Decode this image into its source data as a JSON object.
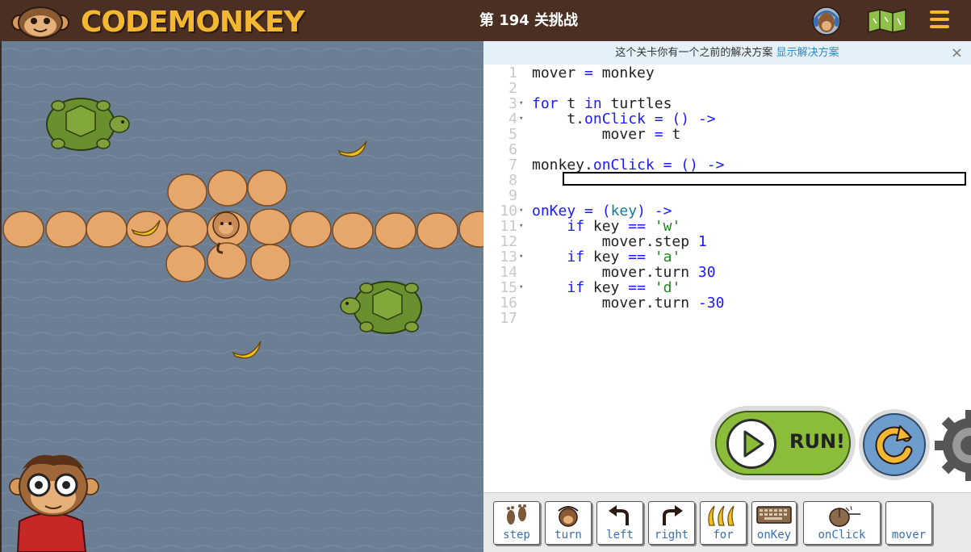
{
  "header": {
    "logo_text": "CODEMONKEY",
    "level_title": "第 194 关挑战",
    "avatar_icon": "monkey-headphones-icon",
    "map_icon": "map-icon",
    "menu_icon": "hamburger-menu-icon",
    "accent_color": "#f4b731",
    "bg_color": "#4b2f22"
  },
  "notice": {
    "text": "这个关卡你有一个之前的解决方案",
    "link": "显示解决方案",
    "close": "×"
  },
  "editor": {
    "lines": [
      {
        "n": "1",
        "fold": ""
      },
      {
        "n": "2",
        "fold": ""
      },
      {
        "n": "3",
        "fold": "▾"
      },
      {
        "n": "4",
        "fold": "▾"
      },
      {
        "n": "5",
        "fold": ""
      },
      {
        "n": "6",
        "fold": ""
      },
      {
        "n": "7",
        "fold": ""
      },
      {
        "n": "8",
        "fold": ""
      },
      {
        "n": "9",
        "fold": ""
      },
      {
        "n": "10",
        "fold": "▾"
      },
      {
        "n": "11",
        "fold": "▾"
      },
      {
        "n": "12",
        "fold": ""
      },
      {
        "n": "13",
        "fold": "▾"
      },
      {
        "n": "14",
        "fold": ""
      },
      {
        "n": "15",
        "fold": "▾"
      },
      {
        "n": "16",
        "fold": ""
      },
      {
        "n": "17",
        "fold": ""
      }
    ],
    "code": [
      "mover = monkey",
      "",
      "for t in turtles",
      "    t.onClick = () ->",
      "        mover = t",
      "",
      "monkey.onClick = () ->",
      "",
      "",
      "onKey = (key) ->",
      "    if key == 'w'",
      "        mover.step 1",
      "    if key == 'a'",
      "        mover.turn 30",
      "    if key == 'd'",
      "        mover.turn -30",
      ""
    ]
  },
  "run": {
    "label": "RUN!",
    "play_icon": "play-icon",
    "reset_icon": "reset-arrow-icon",
    "settings_icon": "gear-icon",
    "color": "#8bbc3a"
  },
  "toolbar": {
    "items": [
      {
        "label": "step",
        "icon": "footsteps-icon"
      },
      {
        "label": "turn",
        "icon": "turn-monkey-icon"
      },
      {
        "label": "left",
        "icon": "left-arrow-icon"
      },
      {
        "label": "right",
        "icon": "right-arrow-icon"
      },
      {
        "label": "for",
        "icon": "bananas-icon"
      },
      {
        "label": "onKey",
        "icon": "keyboard-icon"
      },
      {
        "label": "onClick",
        "icon": "mouse-icon"
      },
      {
        "label": "mover",
        "icon": ""
      }
    ]
  },
  "game": {
    "water_color": "#6c7e93",
    "stone_color": "#e6a76d",
    "turtle_color": "#6a8f2e",
    "banana_color": "#f2c21b"
  }
}
